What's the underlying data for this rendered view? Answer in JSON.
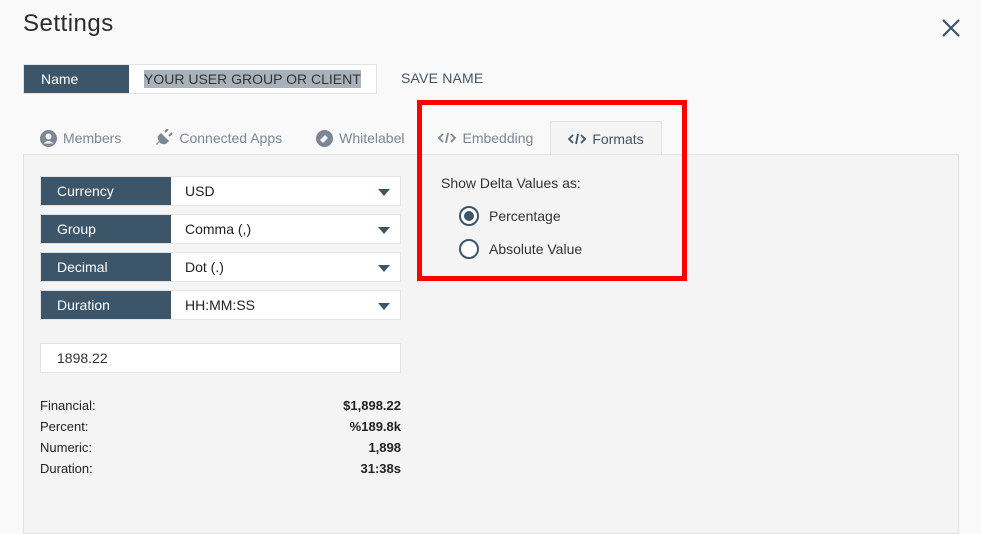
{
  "header": {
    "title": "Settings",
    "close_icon": "close-icon"
  },
  "name_row": {
    "label": "Name",
    "value": "YOUR USER GROUP OR CLIENT",
    "save_label": "SAVE NAME"
  },
  "tabs": [
    {
      "label": "Members",
      "icon": "user-circle-icon",
      "active": false
    },
    {
      "label": "Connected Apps",
      "icon": "plug-icon",
      "active": false
    },
    {
      "label": "Whitelabel",
      "icon": "brush-icon",
      "active": false
    },
    {
      "label": "Embedding",
      "icon": "code-icon",
      "active": false
    },
    {
      "label": "Formats",
      "icon": "code-icon",
      "active": true
    }
  ],
  "selects": [
    {
      "label": "Currency",
      "value": "USD"
    },
    {
      "label": "Group",
      "value": "Comma (,)"
    },
    {
      "label": "Decimal",
      "value": "Dot (.)"
    },
    {
      "label": "Duration",
      "value": "HH:MM:SS"
    }
  ],
  "sample_input": {
    "value": "1898.22"
  },
  "preview": [
    {
      "label": "Financial:",
      "value": "$1,898.22"
    },
    {
      "label": "Percent:",
      "value": "%189.8k"
    },
    {
      "label": "Numeric:",
      "value": "1,898"
    },
    {
      "label": "Duration:",
      "value": "31:38s"
    }
  ],
  "delta": {
    "heading": "Show Delta Values as:",
    "options": [
      {
        "label": "Percentage",
        "selected": true
      },
      {
        "label": "Absolute Value",
        "selected": false
      }
    ]
  },
  "colors": {
    "primary": "#3d5568",
    "highlight": "#ff0000"
  }
}
